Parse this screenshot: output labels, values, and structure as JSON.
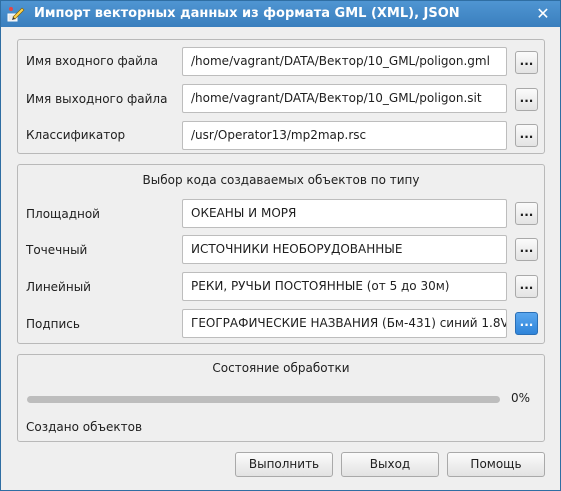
{
  "window": {
    "title": "Импорт векторных данных из формата GML (XML), JSON",
    "close_glyph": "✕"
  },
  "files": {
    "input": {
      "label": "Имя входного файла",
      "value": "/home/vagrant/DATA/Вектор/10_GML/poligon.gml",
      "browse": "..."
    },
    "output": {
      "label": "Имя выходного файла",
      "value": "/home/vagrant/DATA/Вектор/10_GML/poligon.sit",
      "browse": "..."
    },
    "classifier": {
      "label": "Классификатор",
      "value": "/usr/Operator13/mp2map.rsc",
      "browse": "..."
    }
  },
  "codes": {
    "title": "Выбор кода создаваемых объектов по типу",
    "area": {
      "label": "Площадной",
      "value": "ОКЕАНЫ И МОРЯ",
      "browse": "..."
    },
    "point": {
      "label": "Точечный",
      "value": "ИСТОЧНИКИ НЕОБОРУДОВАННЫЕ",
      "browse": "..."
    },
    "linear": {
      "label": "Линейный",
      "value": "РЕКИ, РУЧЬИ ПОСТОЯННЫЕ (от 5 до 30м)",
      "browse": "..."
    },
    "caption": {
      "label": "Подпись",
      "value": "ГЕОГРАФИЧЕСКИЕ НАЗВАНИЯ (Бм-431) синий 1.8V",
      "browse": "..."
    }
  },
  "status": {
    "title": "Состояние обработки",
    "progress_percent": 0,
    "progress_label": "0%",
    "created_label": "Создано объектов"
  },
  "buttons": {
    "run": "Выполнить",
    "exit": "Выход",
    "help": "Помощь"
  },
  "colors": {
    "titlebar": "#3a7fbe",
    "accent": "#2f84d9",
    "progress_track": "#bdbdbd"
  }
}
